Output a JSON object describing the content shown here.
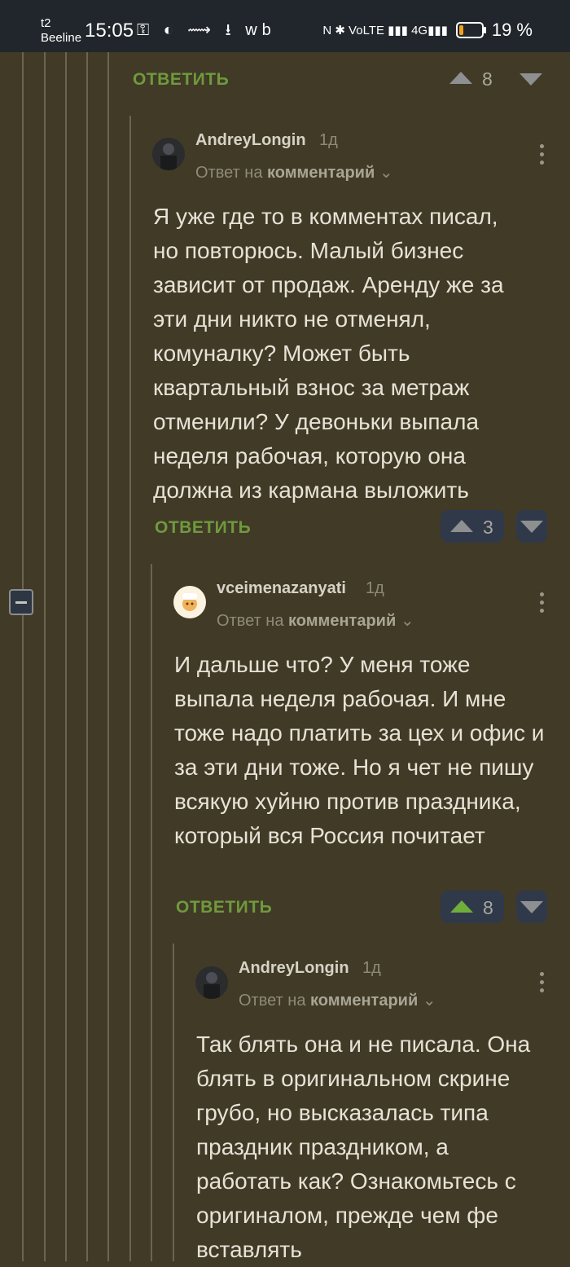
{
  "status_bar": {
    "carrier_top": "t2",
    "carrier_bottom": "Beeline",
    "time": "15:05",
    "icons_left": "⚿ ◐ ⟿ ⭳ wb",
    "icons_right": "N ✱ VoLTE ▮▮▮ 4G▮▮▮",
    "battery_text": "19 %",
    "battery_level": 0.19
  },
  "top_action": {
    "reply_label": "ОТВЕТИТЬ",
    "score": "8"
  },
  "comments": [
    {
      "username": "AndreyLongin",
      "time": "1д",
      "reply_prefix": "Ответ на",
      "reply_target": "комментарий",
      "text": "Я уже где то в комментах писал, но повторюсь. Малый бизнес зависит от продаж. Аренду же за эти дни никто не отменял, комуналку? Может быть квартальный взнос за метраж отменили? У девоньки выпала неделя рабочая, которую она должна из кармана выложить",
      "reply_label": "ОТВЕТИТЬ",
      "score": "3"
    },
    {
      "username": "vceimenazanyati",
      "time": "1д",
      "reply_prefix": "Ответ на",
      "reply_target": "комментарий",
      "text": "И дальше что? У меня тоже выпала неделя рабочая. И мне тоже надо платить за цех и офис и за эти дни тоже. Но я чет не пишу всякую хуйню против праздника, который вся Россия почитает",
      "reply_label": "ОТВЕТИТЬ",
      "score": "8"
    },
    {
      "username": "AndreyLongin",
      "time": "1д",
      "reply_prefix": "Ответ на",
      "reply_target": "комментарий",
      "text": "Так блять она и не писала. Она блять в оригинальном скрине грубо, но высказалась типа праздник праздником, а работать как? Ознакомьтесь с оригиналом, прежде чем фе вставлять"
    }
  ]
}
